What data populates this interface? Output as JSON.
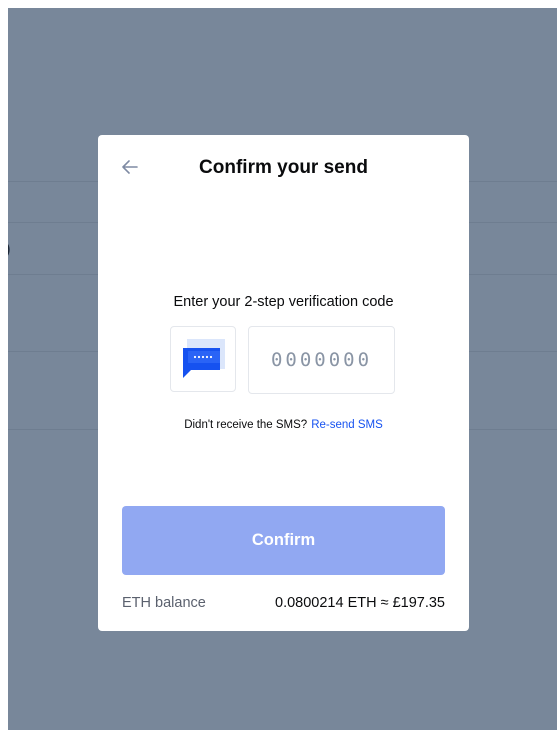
{
  "background": {
    "overlay_color": "#78879a",
    "partial_text": ")"
  },
  "modal": {
    "title": "Confirm your send",
    "back_icon": "arrow-left-icon",
    "verification": {
      "prompt": "Enter your 2-step verification code",
      "sms_icon": "sms-message-icon",
      "code_value": "",
      "code_placeholder": "0000000",
      "resend_text": "Didn't receive the SMS?",
      "resend_link": "Re-send SMS"
    },
    "confirm_label": "Confirm",
    "balance": {
      "label": "ETH balance",
      "value": "0.0800214 ETH ≈ £197.35"
    }
  },
  "colors": {
    "accent": "#1652f0",
    "confirm_disabled": "#91a8f2",
    "icon_light_blue": "#dbe6fb"
  }
}
